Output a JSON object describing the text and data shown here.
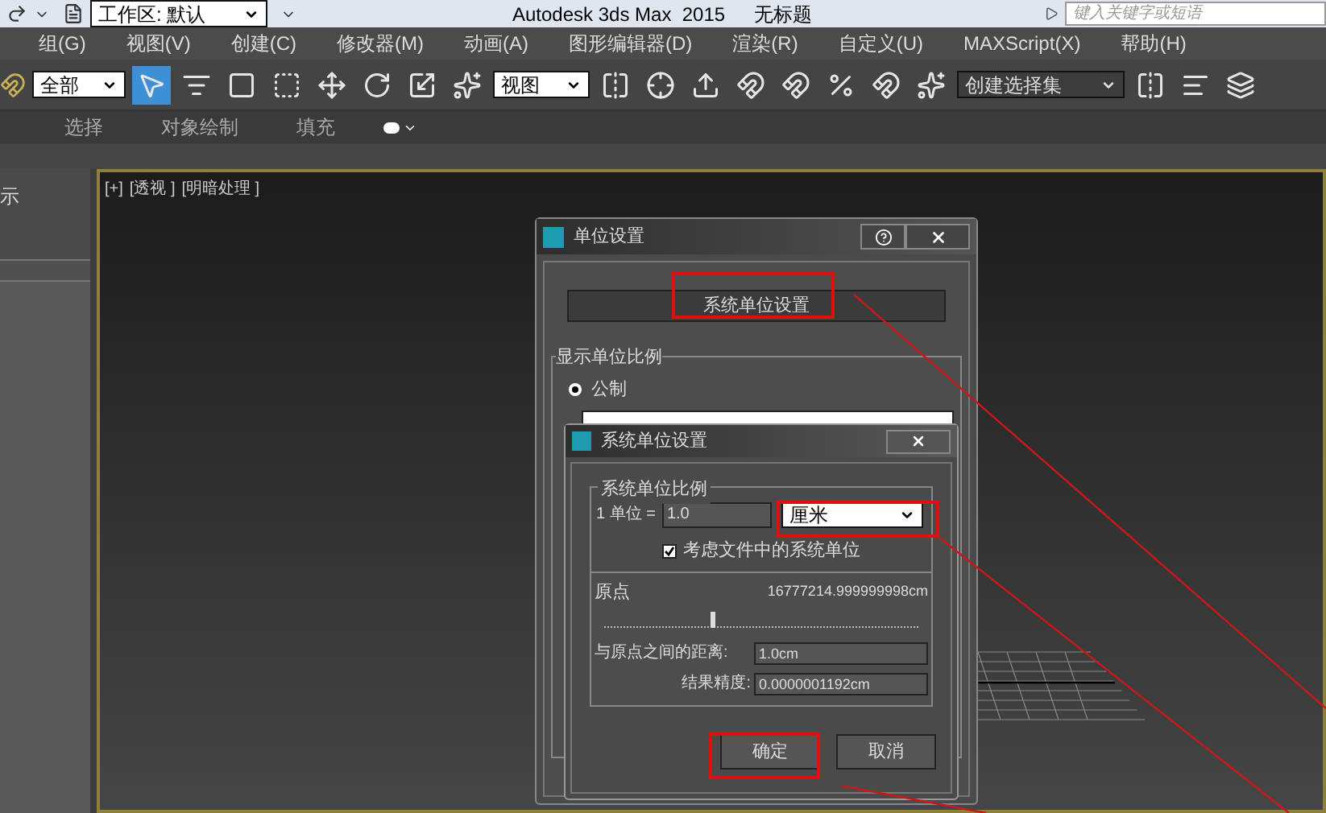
{
  "title_bar": {
    "workspace": "工作区: 默认",
    "title": "Autodesk 3ds Max  2015",
    "document": "无标题",
    "search": {
      "placeholder": "键入关键字或短语"
    }
  },
  "menu": [
    "组(G)",
    "视图(V)",
    "创建(C)",
    "修改器(M)",
    "动画(A)",
    "图形编辑器(D)",
    "渲染(R)",
    "自定义(U)",
    "MAXScript(X)",
    "帮助(H)"
  ],
  "toolbar": {
    "selection_filter": "全部",
    "reference_coordinate": "视图",
    "named_selection": "创建选择集",
    "select_tool": {
      "selected": true
    }
  },
  "ribbon_tabs": [
    "选择",
    "对象绘制",
    "填充"
  ],
  "left_panel": {
    "label": "示"
  },
  "viewport": {
    "labels": [
      "[+]",
      "[透视 ]",
      "[明暗处理 ]"
    ]
  },
  "units_dialog": {
    "title": "单位设置",
    "system_button": "系统单位设置",
    "group": "显示单位比例",
    "options": [
      {
        "label": "公制",
        "selected": true
      }
    ]
  },
  "system_units_dialog": {
    "title": "系统单位设置",
    "group": "系统单位比例",
    "unit_label": "1 单位 =",
    "unit_value": "1.0",
    "unit": "厘米",
    "respect_file": {
      "label": "考虑文件中的系统单位",
      "checked": true
    },
    "origin_label": "原点",
    "origin_value": "16777214.999999998cm",
    "origin_slider": {
      "level": 0.34
    },
    "distance": {
      "label": "与原点之间的距离:",
      "value": "1.0cm"
    },
    "precision": {
      "label": "结果精度:",
      "value": "0.0000001192cm"
    },
    "buttons": [
      "确定",
      "取消"
    ]
  }
}
